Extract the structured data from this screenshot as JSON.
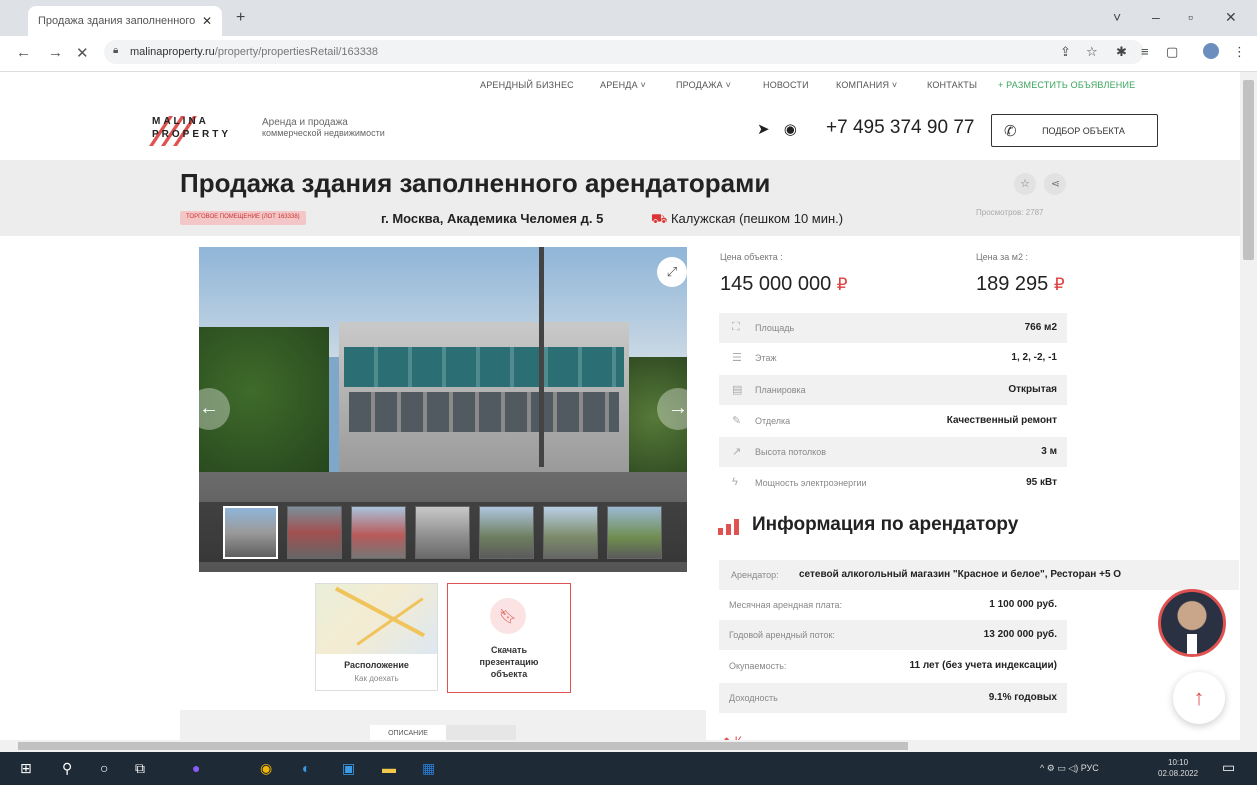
{
  "browser": {
    "tab_title": "Продажа здания заполненного",
    "new_tab": "+",
    "url_domain": "malinaproperty.ru",
    "url_path": "/property/propertiesRetail/163338",
    "minimize": "–",
    "maximize": "▫",
    "close": "✕"
  },
  "topnav": {
    "items": [
      "АРЕНДНЫЙ БИЗНЕС",
      "АРЕНДА ˅",
      "ПРОДАЖА ˅",
      "НОВОСТИ",
      "КОМПАНИЯ ˅",
      "КОНТАКТЫ"
    ],
    "cta": "+ РАЗМЕСТИТЬ ОБЪЯВЛЕНИЕ"
  },
  "header": {
    "logo_line1": "MALINA",
    "logo_line2": "PROPERTY",
    "tagline_1": "Аренда и продажа",
    "tagline_2": "коммерческой недвижимости",
    "phone": "+7 495 374 90 77",
    "pick_button": "ПОДБОР ОБЪЕКТА"
  },
  "listing": {
    "title": "Продажа здания заполненного арендаторами",
    "badge": "ТОРГОВОЕ ПОМЕЩЕНИЕ (ЛОТ 163338)",
    "address": "г. Москва, Академика Челомея д. 5",
    "metro": "Калужская (пешком 10 мин.)",
    "views": "Просмотров: 2787"
  },
  "price": {
    "object_label": "Цена объекта :",
    "object_value": "145 000 000",
    "m2_label": "Цена за м2 :",
    "m2_value": "189 295",
    "currency": "₽"
  },
  "specs": [
    {
      "icon": "area-icon",
      "glyph": "⛶",
      "label": "Площадь",
      "value": "766 м2"
    },
    {
      "icon": "floor-icon",
      "glyph": "☰",
      "label": "Этаж",
      "value": "1, 2, -2, -1"
    },
    {
      "icon": "layout-icon",
      "glyph": "▤",
      "label": "Планировка",
      "value": "Открытая"
    },
    {
      "icon": "finish-icon",
      "glyph": "✎",
      "label": "Отделка",
      "value": "Качественный ремонт"
    },
    {
      "icon": "ceiling-icon",
      "glyph": "↗",
      "label": "Высота потолков",
      "value": "3 м"
    },
    {
      "icon": "power-icon",
      "glyph": "ϟ",
      "label": "Мощность электроэнергии",
      "value": "95 кВт"
    }
  ],
  "tenant": {
    "heading": "Информация по арендатору",
    "tenant_label": "Арендатор:",
    "tenant_value": "сетевой алкогольный магазин \"Красное и белое\", Ресторан +5 О",
    "rows": [
      {
        "label": "Месячная арендная плата:",
        "value": "1 100 000 руб."
      },
      {
        "label": "Годовой арендный поток:",
        "value": "13 200 000 руб."
      },
      {
        "label": "Окупаемость:",
        "value": "11 лет (без учета индексации)"
      },
      {
        "label": "Доходность",
        "value": "9.1% годовых"
      }
    ]
  },
  "cards": {
    "map_title": "Расположение",
    "map_sub": "Как доехать",
    "download_1": "Скачать",
    "download_2": "презентацию",
    "download_3": "объекта"
  },
  "desc_tab": "ОПИСАНИЕ",
  "next_heading_stub": "◆ К",
  "taskbar": {
    "tray": "^ ⚙ ▭ ◁) РУС",
    "time": "10:10",
    "date": "02.08.2022"
  },
  "colors": {
    "accent": "#e05252",
    "green_cta": "#3aa55d",
    "taskbar": "#1e2a36"
  }
}
